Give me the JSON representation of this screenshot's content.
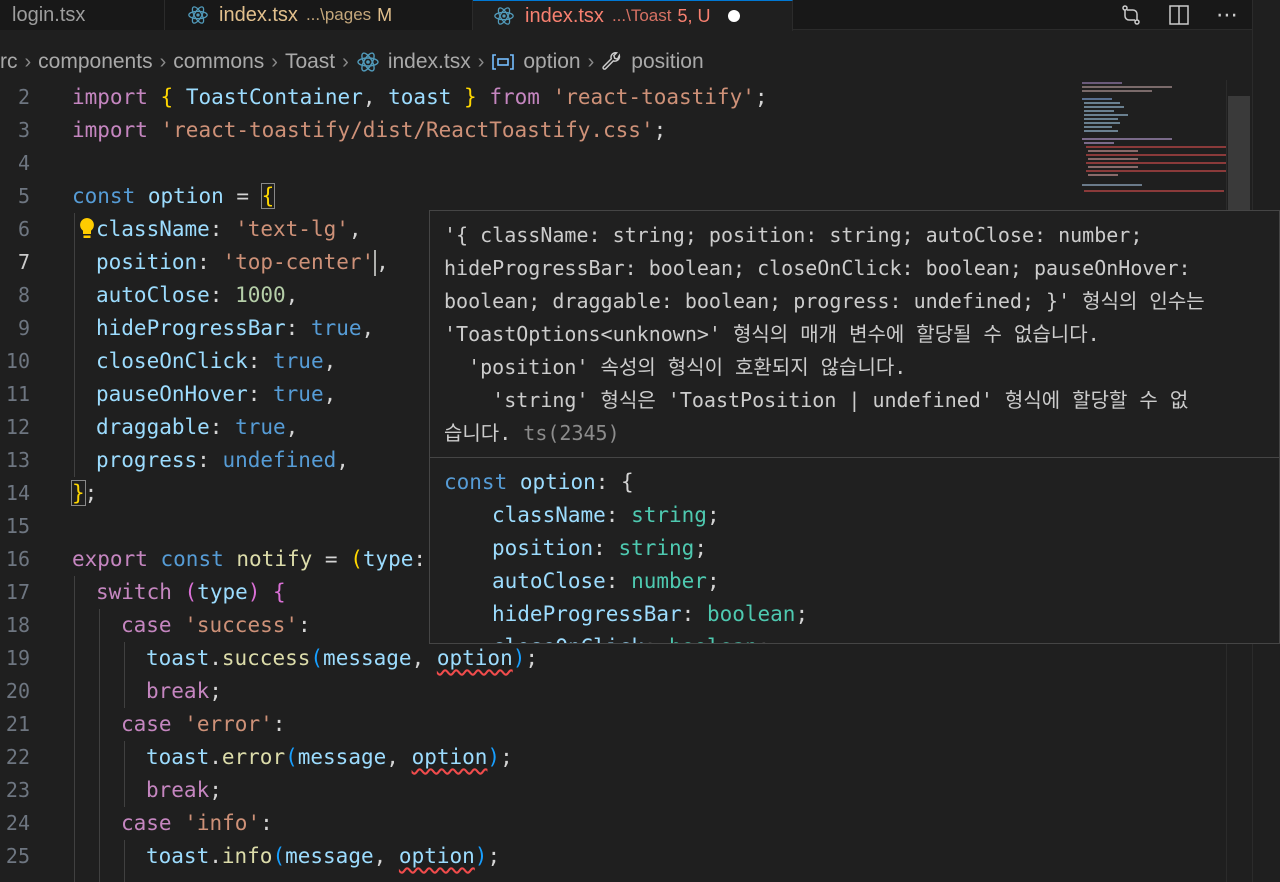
{
  "tabs": [
    {
      "label": "login.tsx",
      "desc": "",
      "badge": ""
    },
    {
      "label": "index.tsx",
      "desc": "...\\pages",
      "badge": "M"
    },
    {
      "label": "index.tsx",
      "desc": "...\\Toast",
      "badge": "5, U"
    }
  ],
  "breadcrumb": [
    "rc",
    "components",
    "commons",
    "Toast",
    "index.tsx",
    "option",
    "position"
  ],
  "line_numbers": [
    "2",
    "3",
    "4",
    "5",
    "6",
    "7",
    "8",
    "9",
    "10",
    "11",
    "12",
    "13",
    "14",
    "15",
    "16",
    "17",
    "18",
    "19",
    "20",
    "21",
    "22",
    "23",
    "24",
    "25"
  ],
  "code": {
    "l2": [
      "import",
      " { ",
      "ToastContainer",
      ", ",
      "toast",
      " } ",
      "from",
      " ",
      "'react-toastify'",
      ";"
    ],
    "l3": [
      "import",
      " ",
      "'react-toastify/dist/ReactToastify.css'",
      ";"
    ],
    "l5": [
      "const",
      " ",
      "option",
      " = ",
      "{"
    ],
    "l6": [
      "className",
      ": ",
      "'text-lg'",
      ","
    ],
    "l7": [
      "position",
      ": ",
      "'top-center'",
      ","
    ],
    "l8": [
      "autoClose",
      ": ",
      "1000",
      ","
    ],
    "l9": [
      "hideProgressBar",
      ": ",
      "true",
      ","
    ],
    "l10": [
      "closeOnClick",
      ": ",
      "true",
      ","
    ],
    "l11": [
      "pauseOnHover",
      ": ",
      "true",
      ","
    ],
    "l12": [
      "draggable",
      ": ",
      "true",
      ","
    ],
    "l13": [
      "progress",
      ": ",
      "undefined",
      ","
    ],
    "l14": [
      "}",
      ";"
    ],
    "l16": [
      "export",
      " ",
      "const",
      " ",
      "notify",
      " = ",
      "(",
      "type",
      ":"
    ],
    "l17": [
      "switch",
      " ",
      "(",
      "type",
      ") ",
      "{"
    ],
    "l18": [
      "case",
      " ",
      "'success'",
      ":"
    ],
    "l19": [
      "toast",
      ".",
      "success",
      "(",
      "message",
      ", ",
      "option",
      ")",
      ";"
    ],
    "l20": [
      "break",
      ";"
    ],
    "l21": [
      "case",
      " ",
      "'error'",
      ":"
    ],
    "l22": [
      "toast",
      ".",
      "error",
      "(",
      "message",
      ", ",
      "option",
      ")",
      ";"
    ],
    "l23": [
      "break",
      ";"
    ],
    "l24": [
      "case",
      " ",
      "'info'",
      ":"
    ],
    "l25": [
      "toast",
      ".",
      "info",
      "(",
      "message",
      ", ",
      "option",
      ")",
      ";"
    ]
  },
  "hover": {
    "message_lines": [
      "'{ className: string; position: string; autoClose: number;",
      "hideProgressBar: boolean; closeOnClick: boolean; pauseOnHover:",
      "boolean; draggable: boolean; progress: undefined; }' 형식의 인수는",
      "'ToastOptions<unknown>' 형식의 매개 변수에 할당될 수 없습니다.",
      "  'position' 속성의 형식이 호환되지 않습니다.",
      "    'string' 형식은 'ToastPosition | undefined' 형식에 할당할 수 없",
      "습니다."
    ],
    "error_code": "ts(2345)",
    "decl": {
      "h1": [
        "const",
        " ",
        "option",
        ": {"
      ],
      "h2": [
        "className",
        ": ",
        "string",
        ";"
      ],
      "h3": [
        "position",
        ": ",
        "string",
        ";"
      ],
      "h4": [
        "autoClose",
        ": ",
        "number",
        ";"
      ],
      "h5": [
        "hideProgressBar",
        ": ",
        "boolean",
        ";"
      ],
      "h6": [
        "closeOnClick",
        ": ",
        "boolean",
        ";"
      ]
    }
  },
  "colors": {
    "editor_bg": "#1f1f1f",
    "keyword_control": "#c586c0",
    "keyword": "#569cd6",
    "variable": "#9cdcfe",
    "string": "#ce9178",
    "number": "#b5cea8",
    "function": "#dcdcaa",
    "type": "#4ec9b0",
    "error_squiggle": "#f14c4c",
    "modified_tab": "#e2c08d",
    "error_tab": "#f88070"
  },
  "icons": [
    "react-icon",
    "dirty-dot-icon",
    "compare-changes-icon",
    "split-editor-icon",
    "more-actions-icon",
    "chevron-right-icon",
    "symbol-variable-icon",
    "wrench-icon",
    "lightbulb-icon"
  ]
}
